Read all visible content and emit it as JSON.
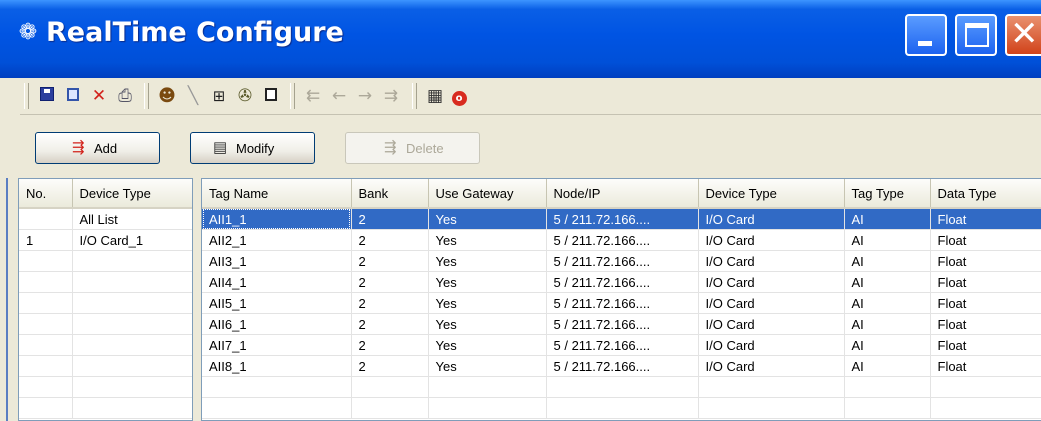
{
  "window": {
    "title": "RealTime Configure",
    "title_icon": "gear-icon"
  },
  "toolbar": {
    "icons": [
      "save-icon",
      "copy-icon",
      "delete-icon",
      "print-icon",
      "users-icon",
      "line-icon",
      "hash-icon",
      "tools-icon",
      "document-icon",
      "align-icon",
      "left-arrow-icon",
      "right-arrow-icon",
      "align-right-icon",
      "chip-icon",
      "stop-icon"
    ]
  },
  "buttons": {
    "add_label": "Add",
    "modify_label": "Modify",
    "delete_label": "Delete"
  },
  "device_list": {
    "headers": [
      "No.",
      "Device Type"
    ],
    "rows": [
      {
        "no": "",
        "device_type": "All List"
      },
      {
        "no": "1",
        "device_type": "I/O Card_1"
      }
    ]
  },
  "tag_table": {
    "headers": [
      "Tag Name",
      "Bank",
      "Use Gateway",
      "Node/IP",
      "Device Type",
      "Tag Type",
      "Data Type"
    ],
    "selected_row": 0,
    "rows": [
      [
        "AII1_1",
        "2",
        "Yes",
        "5 / 211.72.166....",
        "I/O Card",
        "AI",
        "Float"
      ],
      [
        "AII2_1",
        "2",
        "Yes",
        "5 / 211.72.166....",
        "I/O Card",
        "AI",
        "Float"
      ],
      [
        "AII3_1",
        "2",
        "Yes",
        "5 / 211.72.166....",
        "I/O Card",
        "AI",
        "Float"
      ],
      [
        "AII4_1",
        "2",
        "Yes",
        "5 / 211.72.166....",
        "I/O Card",
        "AI",
        "Float"
      ],
      [
        "AII5_1",
        "2",
        "Yes",
        "5 / 211.72.166....",
        "I/O Card",
        "AI",
        "Float"
      ],
      [
        "AII6_1",
        "2",
        "Yes",
        "5 / 211.72.166....",
        "I/O Card",
        "AI",
        "Float"
      ],
      [
        "AII7_1",
        "2",
        "Yes",
        "5 / 211.72.166....",
        "I/O Card",
        "AI",
        "Float"
      ],
      [
        "AII8_1",
        "2",
        "Yes",
        "5 / 211.72.166....",
        "I/O Card",
        "AI",
        "Float"
      ]
    ]
  },
  "colors": {
    "titlebar": "#0054e3",
    "selection": "#316ac5",
    "window_bg": "#ece9d8"
  }
}
